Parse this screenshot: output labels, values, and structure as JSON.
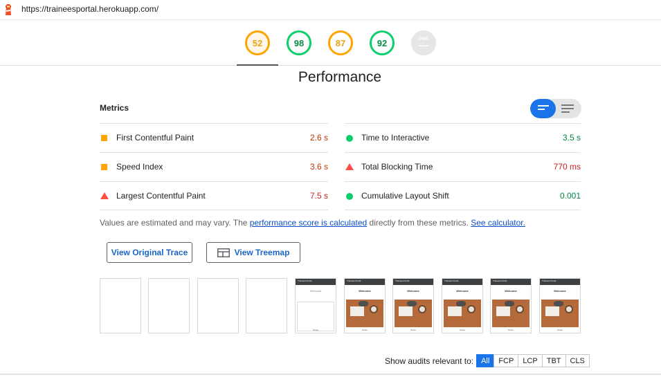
{
  "browser": {
    "url": "https://traineesportal.herokuapp.com/"
  },
  "gauges": [
    {
      "name": "performance",
      "score": "52",
      "status": "average"
    },
    {
      "name": "accessibility",
      "score": "98",
      "status": "pass"
    },
    {
      "name": "best-practices",
      "score": "87",
      "status": "average"
    },
    {
      "name": "seo",
      "score": "92",
      "status": "pass"
    },
    {
      "name": "pwa",
      "score": "—",
      "label": "PWA",
      "status": "na"
    }
  ],
  "category_title": "Performance",
  "metrics": {
    "heading": "Metrics",
    "left": [
      {
        "label": "First Contentful Paint",
        "value": "2.6 s",
        "rating": "average"
      },
      {
        "label": "Speed Index",
        "value": "3.6 s",
        "rating": "average"
      },
      {
        "label": "Largest Contentful Paint",
        "value": "7.5 s",
        "rating": "fail"
      }
    ],
    "right": [
      {
        "label": "Time to Interactive",
        "value": "3.5 s",
        "rating": "pass"
      },
      {
        "label": "Total Blocking Time",
        "value": "770 ms",
        "rating": "fail"
      },
      {
        "label": "Cumulative Layout Shift",
        "value": "0.001",
        "rating": "pass"
      }
    ]
  },
  "note": {
    "prefix": "Values are estimated and may vary. The ",
    "link1": "performance score is calculated",
    "middle": " directly from these metrics. ",
    "link2": "See calculator."
  },
  "buttons": {
    "trace": "View Original Trace",
    "treemap": "View Treemap"
  },
  "filmstrip": {
    "site_title": "Trainees Portal",
    "welcome": "Welcome",
    "footer": "Notes"
  },
  "filter": {
    "label": "Show audits relevant to:",
    "options": [
      "All",
      "FCP",
      "LCP",
      "TBT",
      "CLS"
    ],
    "selected": "All"
  },
  "colors": {
    "accent": "#1a73e8",
    "average": "#ffa400",
    "pass": "#0cce6b",
    "fail": "#ff4e42"
  }
}
